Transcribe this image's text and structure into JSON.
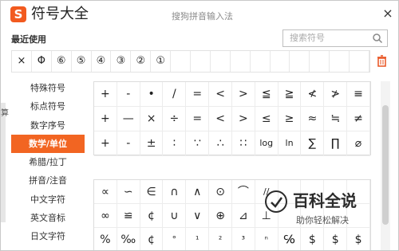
{
  "title": "符号大全",
  "caption": "搜狗拼音输入法",
  "close": "×",
  "recent_label": "最近使用",
  "search_placeholder": "搜索符号",
  "recent": [
    "×",
    "Φ",
    "⑥",
    "⑤",
    "④",
    "③",
    "②",
    "①",
    "",
    "",
    "",
    "",
    "",
    "",
    "",
    "",
    "",
    ""
  ],
  "sidebar": [
    "特殊符号",
    "标点符号",
    "数字序号",
    "数学/单位",
    "希腊/拉丁",
    "拼音/注音",
    "中文字符",
    "英文音标",
    "日文字符"
  ],
  "active_index": 3,
  "grid1": [
    [
      "+",
      "-",
      "•",
      "/",
      "=",
      "<",
      ">",
      "≦",
      "≧",
      "≮",
      "≯",
      "≡"
    ],
    [
      "+",
      "—",
      "×",
      "÷",
      "=",
      "<",
      ">",
      "≤",
      "≥",
      "≈",
      "≒",
      "≠"
    ],
    [
      "+",
      "-",
      "±",
      "∶",
      "∵",
      "∴",
      "∷",
      "log",
      "ln",
      "∑",
      "∏",
      "⌀"
    ]
  ],
  "grid2": [
    [
      "∝",
      "∽",
      "∈",
      "∩",
      "∧",
      "⊙",
      "⌒",
      "//",
      "",
      "",
      "",
      ""
    ],
    [
      "∞",
      "≌",
      "¢",
      "∪",
      "∨",
      "⊕",
      "⊿",
      "⊥",
      "",
      "",
      "",
      ""
    ],
    [
      "%",
      "‰",
      "¢",
      "°",
      "¹",
      "²",
      "³",
      "ⁿ",
      "℅",
      "$",
      "$",
      "$"
    ]
  ],
  "left_strip_label": "算",
  "watermark_big": "百科全说",
  "watermark_small": "助你轻松解决",
  "colors": {
    "accent": "#f26522"
  }
}
